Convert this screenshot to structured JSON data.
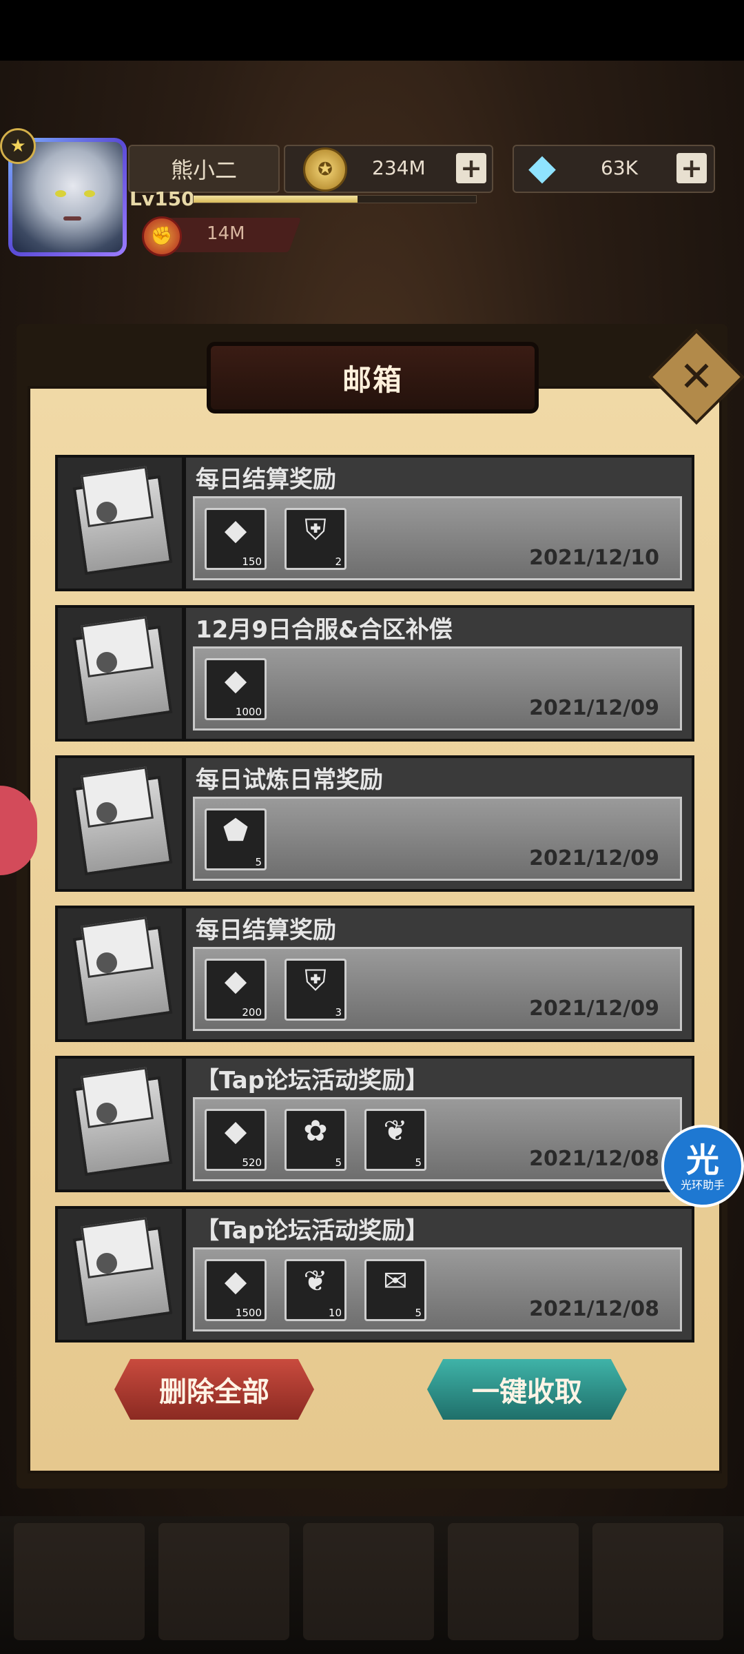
{
  "header": {
    "player_name": "熊小二",
    "level": "Lv150",
    "exp_fraction": 0.58,
    "power": "14M",
    "gold": "234M",
    "gems": "63K",
    "plus": "+"
  },
  "mailbox": {
    "title": "邮箱",
    "close": "✕",
    "mails": [
      {
        "title": "每日结算奖励",
        "date": "2021/12/10",
        "items": [
          {
            "icon": "diamond-icon",
            "glyph": "◆",
            "qty": "150"
          },
          {
            "icon": "armor-icon",
            "glyph": "⛨",
            "qty": "2"
          }
        ]
      },
      {
        "title": "12月9日合服&合区补偿",
        "date": "2021/12/09",
        "items": [
          {
            "icon": "diamond-icon",
            "glyph": "◆",
            "qty": "1000"
          }
        ]
      },
      {
        "title": "每日试炼日常奖励",
        "date": "2021/12/09",
        "items": [
          {
            "icon": "crystal-icon",
            "glyph": "⬟",
            "qty": "5"
          }
        ]
      },
      {
        "title": "每日结算奖励",
        "date": "2021/12/09",
        "items": [
          {
            "icon": "diamond-icon",
            "glyph": "◆",
            "qty": "200"
          },
          {
            "icon": "armor-icon",
            "glyph": "⛨",
            "qty": "3"
          }
        ]
      },
      {
        "title": "【Tap论坛活动奖励】",
        "date": "2021/12/08",
        "items": [
          {
            "icon": "diamond-icon",
            "glyph": "◆",
            "qty": "520"
          },
          {
            "icon": "gift-icon",
            "glyph": "✿",
            "qty": "5"
          },
          {
            "icon": "scroll-icon",
            "glyph": "❦",
            "qty": "5"
          }
        ]
      },
      {
        "title": "【Tap论坛活动奖励】",
        "date": "2021/12/08",
        "items": [
          {
            "icon": "diamond-icon",
            "glyph": "◆",
            "qty": "1500"
          },
          {
            "icon": "scroll-icon",
            "glyph": "❦",
            "qty": "10"
          },
          {
            "icon": "ticket-icon",
            "glyph": "✉",
            "qty": "5"
          }
        ]
      }
    ],
    "delete_all": "删除全部",
    "collect_all": "一键收取"
  },
  "helper": {
    "glyph": "光",
    "label": "光环助手"
  }
}
